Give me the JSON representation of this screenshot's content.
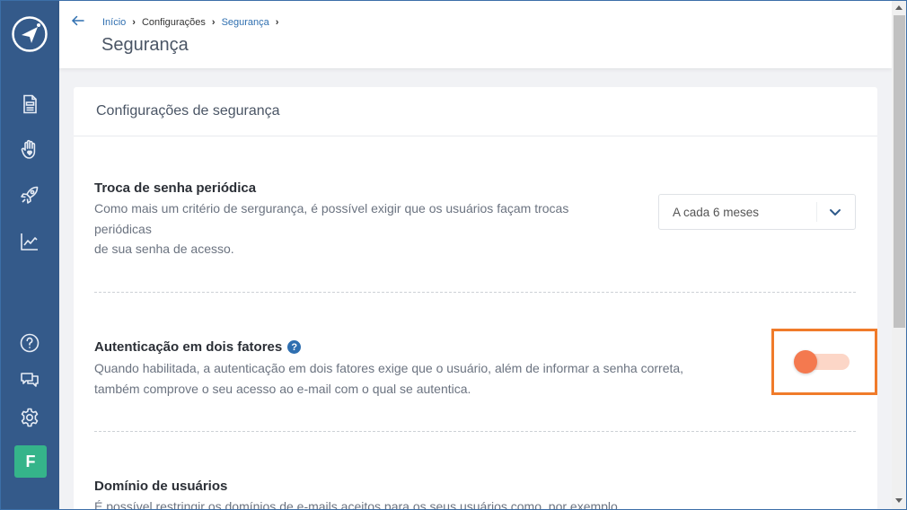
{
  "breadcrumb": {
    "home": "Início",
    "settings": "Configurações",
    "current": "Segurança",
    "sep": "›"
  },
  "page": {
    "title": "Segurança"
  },
  "card": {
    "title": "Configurações de segurança",
    "password_change": {
      "title": "Troca de senha periódica",
      "desc_line1": "Como mais um critério de sergurança, é possível exigir que os usuários façam trocas",
      "desc_line2": "periódicas",
      "desc_line3": "de sua senha de acesso.",
      "select_value": "A cada 6 meses"
    },
    "two_factor": {
      "title": "Autenticação em dois fatores",
      "help": "?",
      "desc_line1": "Quando habilitada, a autenticação em dois fatores exige que o usuário, além de informar a senha correta,",
      "desc_line2": "também comprove o seu acesso ao e-mail com o qual se autentica.",
      "enabled": false
    },
    "user_domain": {
      "title": "Domínio de usuários",
      "desc_line1": "É possível restringir os domínios de e-mails aceitos para os seus usuários como, por exemplo,"
    }
  },
  "sidebar": {
    "items": [
      {
        "icon": "document-icon"
      },
      {
        "icon": "hand-heart-icon"
      },
      {
        "icon": "rocket-icon"
      },
      {
        "icon": "chart-icon"
      },
      {
        "icon": "help-circle-icon"
      },
      {
        "icon": "chat-icon"
      },
      {
        "icon": "gear-icon"
      }
    ],
    "avatar": "F"
  },
  "colors": {
    "sidebar": "#345a8a",
    "accent": "#2f6fb0",
    "toggle": "#f4794f",
    "highlight": "#f07b2a",
    "avatar": "#35b48a"
  }
}
